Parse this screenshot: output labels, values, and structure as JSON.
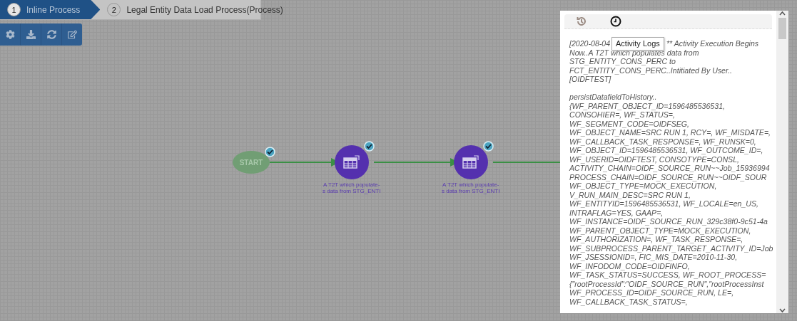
{
  "breadcrumb": [
    {
      "number": "1",
      "label": "Inline Process",
      "selected": true
    },
    {
      "number": "2",
      "label": "Legal Entity Data Load Process(Process)",
      "selected": false
    }
  ],
  "flow": {
    "nodes": [
      {
        "kind": "start",
        "label_lines": [
          "START"
        ],
        "done": true
      },
      {
        "kind": "task",
        "label_lines": [
          "A T2T which populate-",
          "s data from STG_ENTI"
        ],
        "done": true
      },
      {
        "kind": "task",
        "label_lines": [
          "A T2T which populate-",
          "s data from STG_ENTI"
        ],
        "done": true
      }
    ]
  },
  "log_panel": {
    "tabs": [
      {
        "kind": "history",
        "selected": false
      },
      {
        "kind": "clock",
        "selected": true
      }
    ],
    "tooltip": "Activity Logs",
    "first_line": [
      "[2020-08-04",
      "** Activity Execution Begins"
    ],
    "paragraphs": [
      [
        "Now..A T2T which populates data from",
        "STG_ENTITY_CONS_PERC to",
        "FCT_ENTITY_CONS_PERC..Intitiated By User..",
        "[OIDFTEST]"
      ],
      [
        "persistDatafieldToHistory..",
        "{WF_PARENT_OBJECT_ID=1596485536531,",
        "CONSOHIER=, WF_STATUS=,",
        "WF_SEGMENT_CODE=OIDFSEG,",
        "WF_OBJECT_NAME=SRC RUN 1, RCY=, WF_MISDATE=,",
        "WF_CALLBACK_TASK_RESPONSE=, WF_RUNSK=0,",
        "WF_OBJECT_ID=1596485536531, WF_OUTCOME_ID=,",
        "WF_USERID=OIDFTEST, CONSOTYPE=CONSL,",
        "ACTIVITY_CHAIN=OIDF_SOURCE_RUN~~Job_15936994",
        "PROCESS_CHAIN=OIDF_SOURCE_RUN~~OIDF_SOUR",
        "WF_OBJECT_TYPE=MOCK_EXECUTION,",
        "V_RUN_MAIN_DESC=SRC RUN 1,",
        "WF_ENTITYID=1596485536531, WF_LOCALE=en_US,",
        "INTRAFLAG=YES, GAAP=,",
        "WF_INSTANCE=OIDF_SOURCE_RUN_329c38f0-9c51-4a",
        "WF_PARENT_OBJECT_TYPE=MOCK_EXECUTION,",
        "WF_AUTHORIZATION=, WF_TASK_RESPONSE=,",
        "WF_SUBPROCESS_PARENT_TARGET_ACTIVITY_ID=Job",
        "WF_JSESSIONID=, FIC_MIS_DATE=2010-11-30,",
        "WF_INFODOM_CODE=OIDFINFO,",
        "WF_TASK_STATUS=SUCCESS, WF_ROOT_PROCESS=",
        "{\"rootProcessId\":\"OIDF_SOURCE_RUN\",\"rootProcessInst",
        "WF_PROCESS_ID=OIDF_SOURCE_RUN, LE=,",
        "WF_CALLBACK_TASK_STATUS=,"
      ]
    ]
  }
}
